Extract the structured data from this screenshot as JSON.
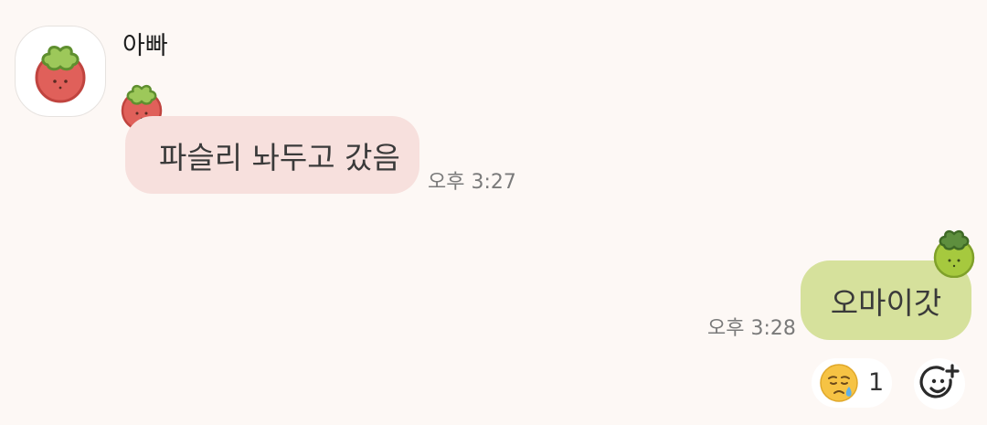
{
  "contact": {
    "name": "아빠",
    "avatar_icon": "tomato-character-icon"
  },
  "messages": [
    {
      "direction": "incoming",
      "sticker_icon": "tomato-character-icon",
      "text": "파슬리 놔두고 갔음",
      "time": "오후 3:27",
      "bubble_color": "#f7e0dd"
    },
    {
      "direction": "outgoing",
      "sticker_icon": "green-tomato-character-icon",
      "text": "오마이갓",
      "time": "오후 3:28",
      "bubble_color": "#d6e19c"
    }
  ],
  "reaction": {
    "emoji": "sad-tear-face-icon",
    "count": "1"
  },
  "add_reaction_icon": "add-emoji-icon",
  "colors": {
    "background": "#fdf8f5",
    "tomato_red": "#e0605a",
    "leaf_green": "#8fbf4a",
    "green_tomato": "#a6c93e"
  }
}
